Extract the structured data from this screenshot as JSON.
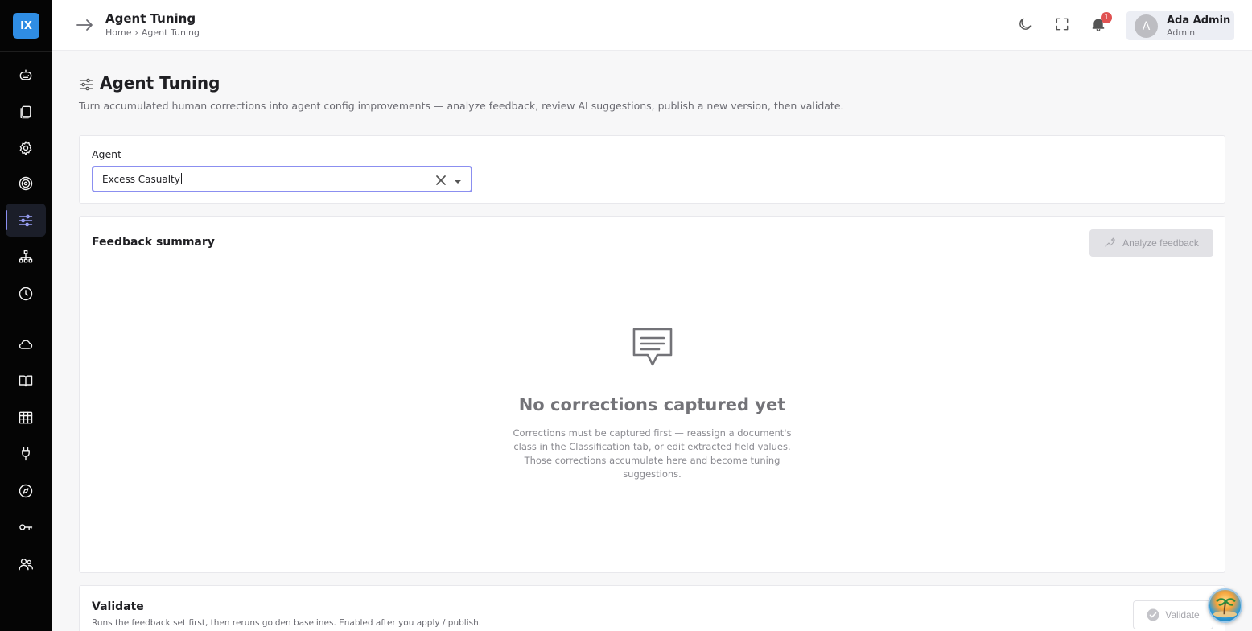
{
  "app": {
    "logo_text": "IX"
  },
  "header": {
    "title": "Agent Tuning",
    "breadcrumb": [
      "Home",
      "›",
      "Agent Tuning"
    ],
    "notification_count": "1",
    "user": {
      "initial": "A",
      "name": "Ada Admin",
      "role": "Admin"
    }
  },
  "sidebar": {
    "items": [
      {
        "name": "robot-icon",
        "active": false
      },
      {
        "name": "documents-icon",
        "active": false
      },
      {
        "name": "gear-icon",
        "active": false
      },
      {
        "name": "target-icon",
        "active": false
      },
      {
        "name": "sliders-icon",
        "active": true
      },
      {
        "name": "hierarchy-icon",
        "active": false
      },
      {
        "name": "history-icon",
        "active": false
      },
      {
        "name": "cloud-icon",
        "active": false
      },
      {
        "name": "book-icon",
        "active": false
      },
      {
        "name": "table-icon",
        "active": false
      },
      {
        "name": "plug-icon",
        "active": false
      },
      {
        "name": "compass-icon",
        "active": false
      },
      {
        "name": "key-icon",
        "active": false
      },
      {
        "name": "users-icon",
        "active": false
      }
    ]
  },
  "page": {
    "title": "Agent Tuning",
    "description": "Turn accumulated human corrections into agent config improvements — analyze feedback, review AI suggestions, publish a new version, then validate."
  },
  "agent": {
    "label": "Agent",
    "value": "Excess Casualty"
  },
  "feedback": {
    "title": "Feedback summary",
    "analyze_label": "Analyze feedback",
    "empty_title": "No corrections captured yet",
    "empty_desc": "Corrections must be captured first — reassign a document's class in the Classification tab, or edit extracted field values. Those corrections accumulate here and become tuning suggestions."
  },
  "validate": {
    "title": "Validate",
    "description": "Runs the feedback set first, then reruns golden baselines. Enabled after you apply / publish.",
    "button_label": "Validate"
  },
  "colors": {
    "accent": "#8b8ff0",
    "logo": "#2f8de4",
    "sidebar_bg": "#050505",
    "badge": "#e05252"
  }
}
